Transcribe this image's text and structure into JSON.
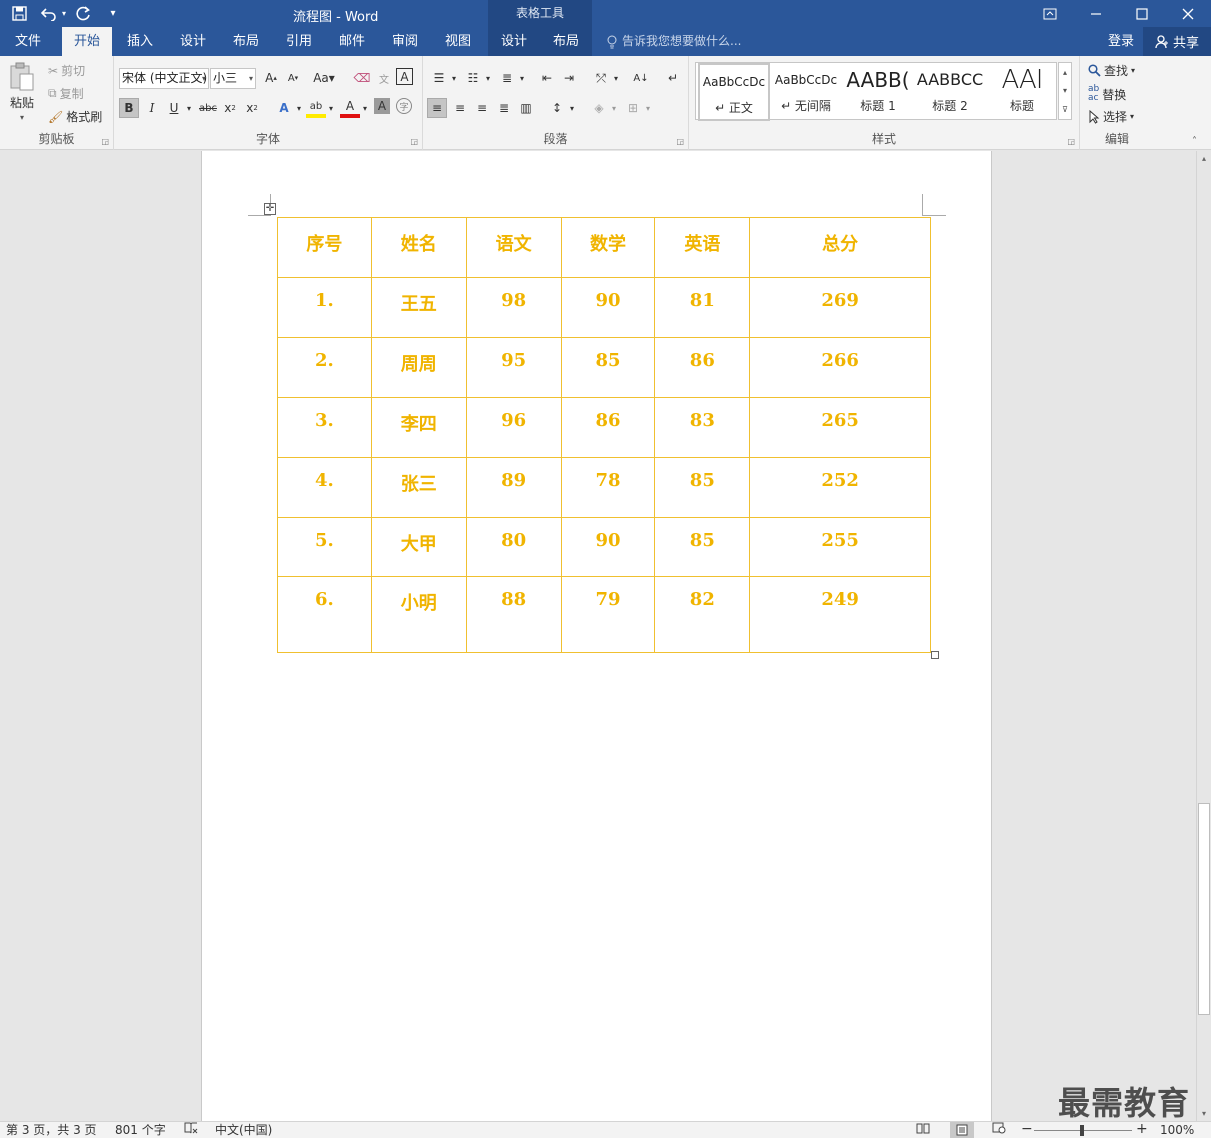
{
  "app": {
    "title": "流程图 - Word",
    "context_tab_group": "表格工具"
  },
  "tabs": [
    {
      "label": "文件"
    },
    {
      "label": "开始"
    },
    {
      "label": "插入"
    },
    {
      "label": "设计"
    },
    {
      "label": "布局"
    },
    {
      "label": "引用"
    },
    {
      "label": "邮件"
    },
    {
      "label": "审阅"
    },
    {
      "label": "视图"
    },
    {
      "label": "设计"
    },
    {
      "label": "布局"
    }
  ],
  "tell_me": "告诉我您想要做什么...",
  "signin": "登录",
  "share": "共享",
  "ribbon": {
    "clipboard": {
      "label": "剪贴板",
      "paste": "粘贴",
      "cut": "剪切",
      "copy": "复制",
      "format_painter": "格式刷"
    },
    "font": {
      "label": "字体",
      "font_name": "宋体 (中文正文)",
      "font_size": "小三"
    },
    "paragraph": {
      "label": "段落"
    },
    "styles": {
      "label": "样式",
      "items": [
        {
          "preview": "AaBbCcDc",
          "name": "↵ 正文"
        },
        {
          "preview": "AaBbCcDc",
          "name": "↵ 无间隔"
        },
        {
          "preview": "AABB(",
          "name": "标题 1"
        },
        {
          "preview": "AABBCC",
          "name": "标题 2"
        },
        {
          "preview": "AAI",
          "name": "标题"
        }
      ]
    },
    "editing": {
      "label": "编辑",
      "find": "查找",
      "replace": "替换",
      "select": "选择"
    }
  },
  "table": {
    "headers": [
      "序号",
      "姓名",
      "语文",
      "数学",
      "英语",
      "总分"
    ],
    "rows": [
      [
        "1.",
        "王五",
        "98",
        "90",
        "81",
        "269"
      ],
      [
        "2.",
        "周周",
        "95",
        "85",
        "86",
        "266"
      ],
      [
        "3.",
        "李四",
        "96",
        "86",
        "83",
        "265"
      ],
      [
        "4.",
        "张三",
        "89",
        "78",
        "85",
        "252"
      ],
      [
        "5.",
        "大甲",
        "80",
        "90",
        "85",
        "255"
      ],
      [
        "6.",
        "小明",
        "88",
        "79",
        "82",
        "249"
      ]
    ]
  },
  "status": {
    "page": "第 3 页，共 3 页",
    "words": "801 个字",
    "language": "中文(中国)",
    "zoom": "100%"
  },
  "watermark": "最需教育",
  "colors": {
    "brand": "#2b579a",
    "table_text": "#f0b400",
    "table_border": "#f0c030"
  }
}
